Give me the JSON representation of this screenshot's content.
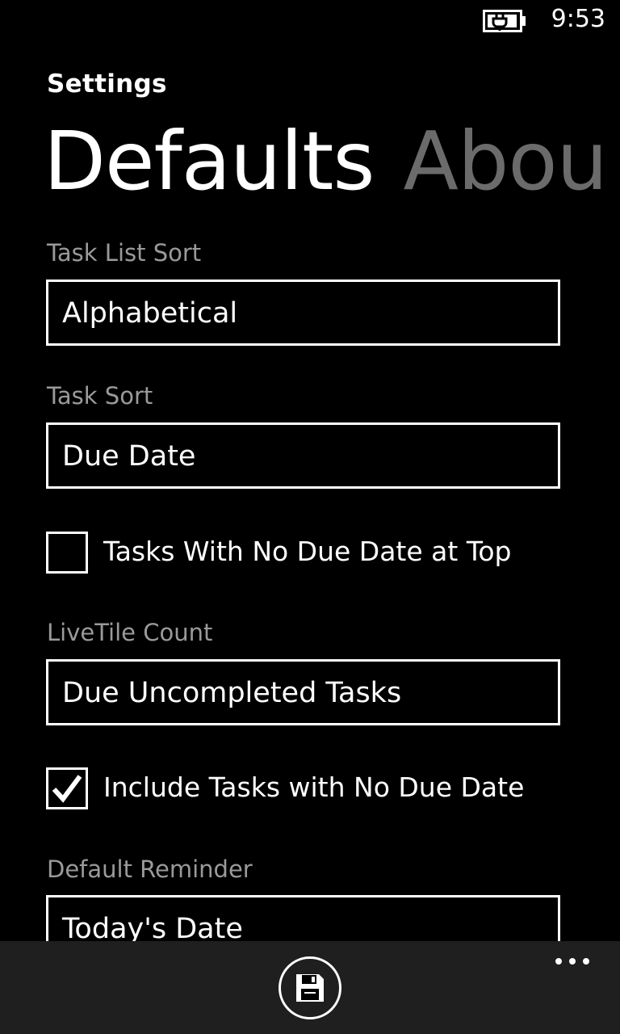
{
  "status_bar": {
    "battery_icon": "battery-charging-icon",
    "time": "9:53"
  },
  "app_title": "Settings",
  "pivot": {
    "tabs": [
      {
        "label": "Defaults",
        "active": true
      },
      {
        "label": "Abou",
        "active": false
      }
    ]
  },
  "settings": {
    "task_list_sort": {
      "label": "Task List Sort",
      "value": "Alphabetical"
    },
    "task_sort": {
      "label": "Task Sort",
      "value": "Due Date"
    },
    "no_due_date_top": {
      "label": "Tasks With No Due Date at Top",
      "checked": false
    },
    "livetile_count": {
      "label": "LiveTile Count",
      "value": "Due Uncompleted Tasks"
    },
    "include_no_due_date": {
      "label": "Include Tasks with No Due Date",
      "checked": true
    },
    "default_reminder": {
      "label": "Default Reminder",
      "value": "Today's Date"
    }
  },
  "app_bar": {
    "save_icon": "save-icon",
    "more_icon": "ellipsis-icon"
  },
  "colors": {
    "background": "#000000",
    "foreground": "#ffffff",
    "subtle_label": "#9a9a9a",
    "inactive_pivot": "#6b6b6b",
    "app_bar": "#1f1f1f"
  }
}
